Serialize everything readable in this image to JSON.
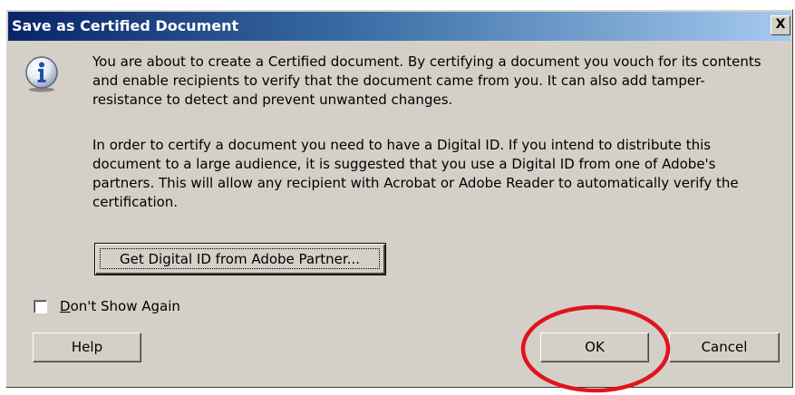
{
  "dialog": {
    "title": "Save as Certified Document",
    "close_glyph": "X",
    "icon": "info-icon",
    "paragraph1": "You are about to create a Certified document. By certifying a document you vouch for its contents and enable recipients to verify that the document came from you. It can also add tamper-resistance to detect and prevent unwanted changes.",
    "paragraph2": "In order to certify a document you need to have a Digital ID. If you intend to distribute this document to a large audience, it is suggested that you use a Digital ID from one of Adobe's partners. This will allow any recipient with Acrobat or Adobe Reader to automatically verify the certification.",
    "adobe_button_label": "Get Digital ID from Adobe Partner...",
    "checkbox": {
      "mnemonic": "D",
      "label_rest": "on't Show Again",
      "checked": false
    },
    "buttons": {
      "help": "Help",
      "ok": "OK",
      "cancel": "Cancel"
    }
  },
  "annotation": {
    "shape": "ellipse",
    "color": "#e0141e",
    "target": "ok-button"
  },
  "colors": {
    "titlebar_start": "#0a246a",
    "titlebar_end": "#a6caf0",
    "dialog_face": "#d4d0c8",
    "icon_blue": "#1f4fb4"
  }
}
